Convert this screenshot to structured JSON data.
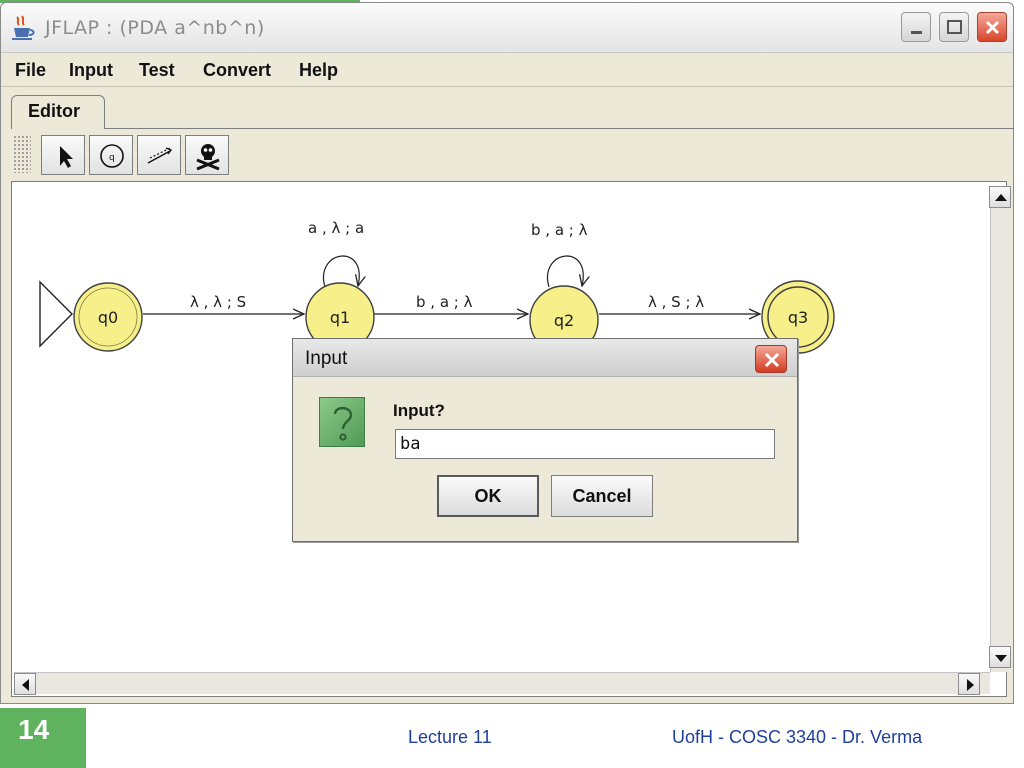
{
  "window": {
    "title": "JFLAP : (PDA a^nb^n)"
  },
  "menu": {
    "items": [
      "File",
      "Input",
      "Test",
      "Convert",
      "Help"
    ]
  },
  "tabs": [
    {
      "label": "Editor",
      "active": true
    }
  ],
  "toolbar": {
    "tools": [
      {
        "name": "pointer",
        "icon": "arrow-pointer-icon"
      },
      {
        "name": "state-creator",
        "icon": "state-creator-icon"
      },
      {
        "name": "transition-creator",
        "icon": "transition-arrow-icon"
      },
      {
        "name": "deleter",
        "icon": "skull-crossbones-icon"
      }
    ]
  },
  "diagram": {
    "states": [
      {
        "id": "q0",
        "label": "q0",
        "initial": true,
        "final": false
      },
      {
        "id": "q1",
        "label": "q1",
        "initial": false,
        "final": false
      },
      {
        "id": "q2",
        "label": "q2",
        "initial": false,
        "final": false
      },
      {
        "id": "q3",
        "label": "q3",
        "initial": false,
        "final": true
      }
    ],
    "transitions": [
      {
        "from": "q0",
        "to": "q1",
        "label": "λ , λ ; S"
      },
      {
        "from": "q1",
        "to": "q1",
        "label": "a , λ ; a"
      },
      {
        "from": "q1",
        "to": "q2",
        "label": "b , a ; λ"
      },
      {
        "from": "q2",
        "to": "q2",
        "label": "b , a ; λ"
      },
      {
        "from": "q2",
        "to": "q3",
        "label": "λ , S ; λ"
      }
    ],
    "state_fill": "#f7f08a",
    "state_stroke": "#404040"
  },
  "dialog": {
    "title": "Input",
    "prompt": "Input?",
    "input_value": "ba",
    "ok_label": "OK",
    "cancel_label": "Cancel",
    "icon": "question-mark-icon"
  },
  "footer": {
    "slide_number": "14",
    "lecture": "Lecture 11",
    "course": "UofH - COSC 3340 - Dr. Verma"
  },
  "colors": {
    "accent": "#5fb35f",
    "footer_text": "#1f3f9f",
    "close_button": "#d8452b"
  }
}
